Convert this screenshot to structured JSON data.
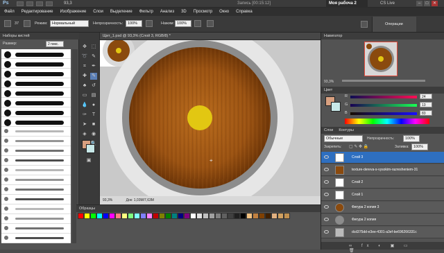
{
  "titlebar": {
    "logo": "Ps",
    "zoom": "93,3",
    "record": "Запись [00:15:12]",
    "workspace": "Моя рабоча 2",
    "cslive": "CS Live",
    "min": "–",
    "max": "□",
    "close": "✕"
  },
  "menu": [
    "Файл",
    "Редактирование",
    "Изображение",
    "Слои",
    "Выделение",
    "Фильтр",
    "Анализ",
    "3D",
    "Просмотр",
    "Окно",
    "Справка"
  ],
  "options": {
    "size_value": "37",
    "mode_label": "Режим:",
    "mode_value": "Нормальный",
    "opacity_label": "Непрозрачность:",
    "opacity_value": "100%",
    "flow_label": "Нажим:",
    "flow_value": "100%",
    "operations_label": "Операции"
  },
  "brushes": {
    "title": "Наборы кистей",
    "size_label": "Размер:",
    "size_value": "2 пикс."
  },
  "document": {
    "tab": "Щит_1.psd @ 93,3% (Слой 3, RGB/8) *",
    "zoom": "93,3%",
    "doc_info": "Док: 1,03M/7,63M"
  },
  "swatches": {
    "title": "Образцы",
    "colors": [
      "#ff0000",
      "#ffff00",
      "#00ff00",
      "#00ffff",
      "#0000ff",
      "#ff00ff",
      "#ff8080",
      "#ffff80",
      "#80ff80",
      "#80ffff",
      "#8080ff",
      "#ff80ff",
      "#c00000",
      "#808000",
      "#008000",
      "#008080",
      "#000080",
      "#800080",
      "#ffffff",
      "#e0e0e0",
      "#c0c0c0",
      "#a0a0a0",
      "#808080",
      "#606060",
      "#404040",
      "#202020",
      "#000000",
      "#f0c080",
      "#c08040",
      "#804000",
      "#402000",
      "#e0b080",
      "#d0a060",
      "#c09050"
    ]
  },
  "navigator": {
    "title": "Навигатор",
    "zoom": "93,3%"
  },
  "color": {
    "tab": "Цвет",
    "r_label": "R",
    "r_value": "24",
    "g_label": "G",
    "g_value": "13",
    "b_label": "B",
    "b_value": "83",
    "fg": "#d8a080",
    "bg": "#c8e8e8"
  },
  "layers": {
    "tab1": "Слои",
    "tab2": "Контуры",
    "blend": "Обычные",
    "opacity_label": "Непрозрачность:",
    "opacity_value": "100%",
    "lock_label": "Закрепить:",
    "fill_label": "Заливка:",
    "fill_value": "100%",
    "items": [
      {
        "name": "Слой 3",
        "selected": true
      },
      {
        "name": "texture-dereva-s-vysokim-razresheniem-31",
        "selected": false
      },
      {
        "name": "Слой 2",
        "selected": false
      },
      {
        "name": "Слой 1",
        "selected": false
      },
      {
        "name": "Фигура 2 копия 3",
        "selected": false
      },
      {
        "name": "Фигура 2 копия",
        "selected": false
      },
      {
        "name": "dcd375dd-e3ee-4301-a3ef-be696266331c",
        "selected": false
      }
    ]
  },
  "colors": {
    "wood": "#8a4a0e",
    "wood_light": "#b06018",
    "yellow": "#e2c712",
    "selection": "#2e6fc0"
  }
}
